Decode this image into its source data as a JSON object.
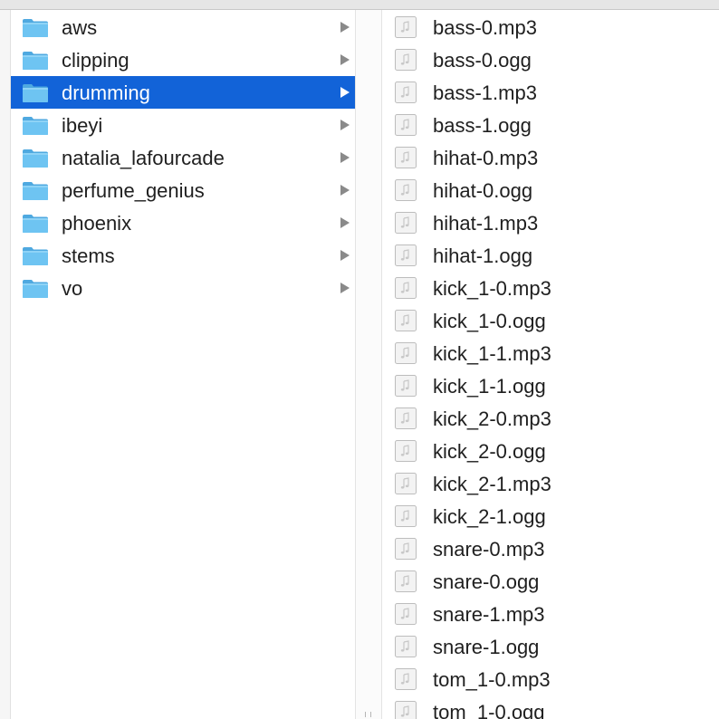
{
  "folders": [
    {
      "name": "aws",
      "selected": false
    },
    {
      "name": "clipping",
      "selected": false
    },
    {
      "name": "drumming",
      "selected": true
    },
    {
      "name": "ibeyi",
      "selected": false
    },
    {
      "name": "natalia_lafourcade",
      "selected": false
    },
    {
      "name": "perfume_genius",
      "selected": false
    },
    {
      "name": "phoenix",
      "selected": false
    },
    {
      "name": "stems",
      "selected": false
    },
    {
      "name": "vo",
      "selected": false
    }
  ],
  "files": [
    "bass-0.mp3",
    "bass-0.ogg",
    "bass-1.mp3",
    "bass-1.ogg",
    "hihat-0.mp3",
    "hihat-0.ogg",
    "hihat-1.mp3",
    "hihat-1.ogg",
    "kick_1-0.mp3",
    "kick_1-0.ogg",
    "kick_1-1.mp3",
    "kick_1-1.ogg",
    "kick_2-0.mp3",
    "kick_2-0.ogg",
    "kick_2-1.mp3",
    "kick_2-1.ogg",
    "snare-0.mp3",
    "snare-0.ogg",
    "snare-1.mp3",
    "snare-1.ogg",
    "tom_1-0.mp3",
    "tom_1-0.ogg"
  ],
  "icons": {
    "folder": "folder-icon",
    "audio_file": "audio-file-icon",
    "disclosure": "chevron-right-icon"
  },
  "colors": {
    "selection": "#1263d8",
    "folder": "#6ec4f2"
  }
}
